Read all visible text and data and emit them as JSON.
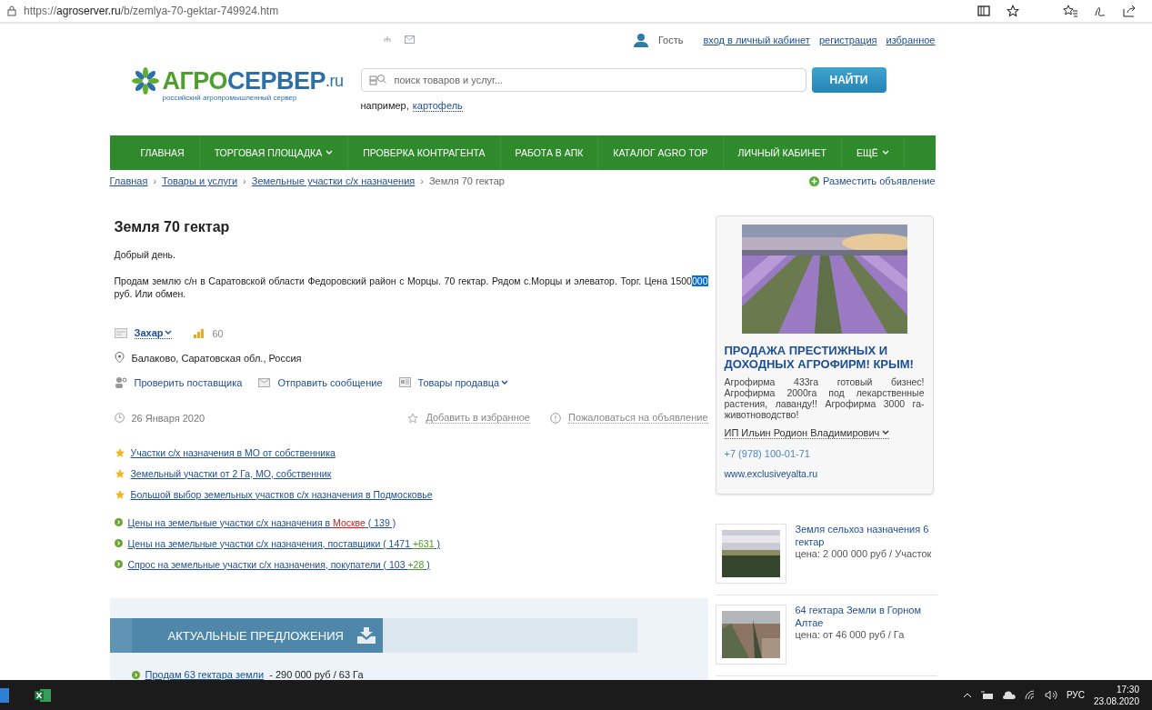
{
  "browser": {
    "url_host": "agroserver.ru",
    "url_prefix": "https://",
    "url_path": "/b/zemlya-70-gektar-749924.htm"
  },
  "header": {
    "user": "Гость",
    "links": [
      "вход в личный кабинет",
      "регистрация",
      "избранное"
    ],
    "logo_main_a": "АГРО",
    "logo_main_b": "СЕРВЕР",
    "logo_suffix": ".ru",
    "logo_tagline": "российский агропромышленный сервер",
    "search_placeholder": "поиск товаров и услуг...",
    "search_button": "НАЙТИ",
    "example_label": "например,",
    "example_link": "картофель"
  },
  "nav": [
    {
      "label": "ГЛАВНАЯ",
      "dropdown": false
    },
    {
      "label": "ТОРГОВАЯ ПЛОЩАДКА",
      "dropdown": true
    },
    {
      "label": "ПРОВЕРКА КОНТРАГЕНТА",
      "dropdown": false
    },
    {
      "label": "РАБОТА В АПК",
      "dropdown": false
    },
    {
      "label": "КАТАЛОГ AGRO TOP",
      "dropdown": false
    },
    {
      "label": "ЛИЧНЫЙ КАБИНЕТ",
      "dropdown": false
    },
    {
      "label": "ЕЩЁ",
      "dropdown": true
    }
  ],
  "breadcrumbs": [
    {
      "label": "Главная",
      "link": true
    },
    {
      "separator": "›",
      "label": "Товары и услуги",
      "link": true
    },
    {
      "separator": "›",
      "label": "Земельные участки с/х назначения",
      "link": true
    },
    {
      "separator": "›",
      "label": "Земля 70 гектар",
      "link": false
    }
  ],
  "post_ad": "Разместить объявление",
  "listing": {
    "title": "Земля 70 гектар",
    "greeting": "Добрый день.",
    "description": [
      {
        "text": "Продам землю с/н в Саратовской области Федоровский район с Морцы. 70 гектар. Рядом с.Морцы и элеватор. Торг. Цена 1500",
        "selected": false
      },
      {
        "text": "000 ",
        "selected": true
      },
      {
        "text": "руб. Или обмен.",
        "selected": false
      }
    ],
    "seller": "Захар",
    "views": "60",
    "location": "Балаково, Саратовская обл., Россия",
    "actions": [
      {
        "kind": "check",
        "label": "Проверить поставщика"
      },
      {
        "kind": "message",
        "label": "Отправить сообщение"
      },
      {
        "kind": "goods",
        "label": "Товары продавца"
      }
    ],
    "date": "26 Января 2020",
    "favorite": "Добавить в избранное",
    "complain": "Пожаловаться на объявление"
  },
  "related": [
    {
      "kind": "star",
      "parts": [
        {
          "text": "Участки с/х назначения в МО от собственника"
        }
      ]
    },
    {
      "kind": "star",
      "parts": [
        {
          "text": "Земельный участки от 2 Га, МО, собственник"
        }
      ]
    },
    {
      "kind": "star",
      "parts": [
        {
          "text": "Большой выбор земельных участков с/х назначения в Подмосковье"
        }
      ]
    },
    {
      "kind": "price",
      "parts": [
        {
          "text": "Цены на земельные участки с/х назначения в "
        },
        {
          "text": "Москве",
          "color": "#c0251b"
        },
        {
          "text": " ( 139 )"
        }
      ]
    },
    {
      "kind": "price",
      "parts": [
        {
          "text": "Цены на земельные участки с/х назначения, поставщики ( 1471 "
        },
        {
          "text": "+631",
          "color": "#4c9a2a"
        },
        {
          "text": " )"
        }
      ]
    },
    {
      "kind": "price",
      "parts": [
        {
          "text": "Спрос на земельные участки с/х назначения, покупатели ( 103 "
        },
        {
          "text": "+28",
          "color": "#4c9a2a"
        },
        {
          "text": " )"
        }
      ]
    }
  ],
  "offers": {
    "title": "АКТУАЛЬНЫЕ ПРЕДЛОЖЕНИЯ",
    "items": [
      {
        "link": "Продам 63 гектара земли",
        "price": " - 290 000 руб / 63 Га"
      }
    ]
  },
  "ad": {
    "kind": "picture",
    "title": "ПРОДАЖА ПРЕСТИЖНЫХ И ДОХОДНЫХ АГРОФИРМ! КРЫМ!",
    "text": "Агрофирма 433га готовый бизнес! Агрофирма 2000га под лекарственные растения, лаванду!! Агрофирма 3000 га- животноводство!",
    "company": "ИП Ильин Родион Владимирович",
    "phone": "+7 (978) 100-01-71",
    "site": "www.exclusiveyalta.ru"
  },
  "side_listings": [
    {
      "kind": "picture",
      "title": "Земля сельхоз назначения 6 гектар",
      "price": "цена: 2 000 000 руб / Участок"
    },
    {
      "kind": "picture",
      "title": "64 гектара Земли в Горном Алтае",
      "price": "цена: от 46 000 руб / Га"
    }
  ],
  "taskbar": {
    "language": "РУС",
    "time": "17:30",
    "date": "23.08.2020"
  }
}
